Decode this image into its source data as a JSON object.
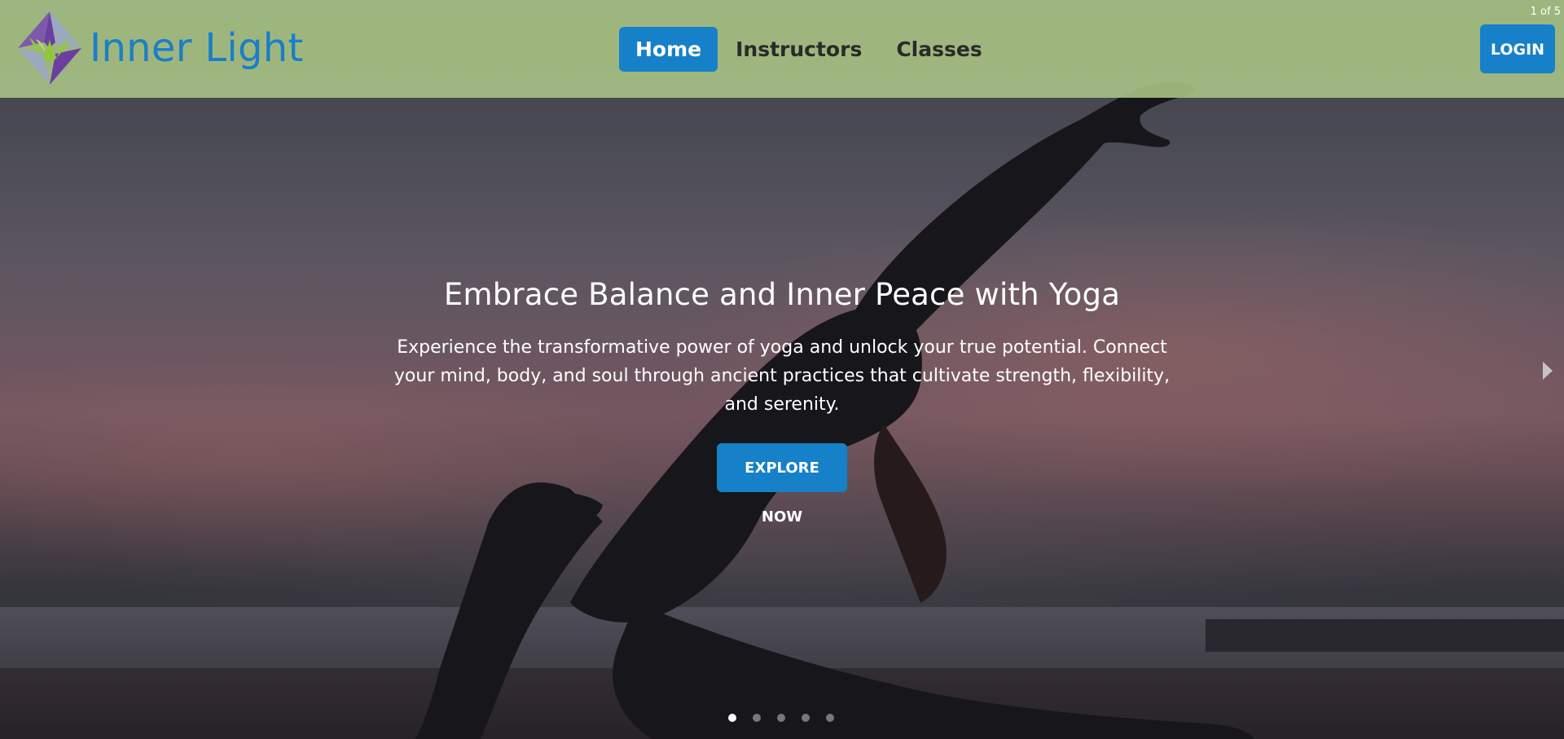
{
  "brand": {
    "name": "Inner Light",
    "logo_icon": "lotus-diamond-icon",
    "color": "#1a7fc6"
  },
  "nav": {
    "items": [
      {
        "label": "Home",
        "active": true
      },
      {
        "label": "Instructors",
        "active": false
      },
      {
        "label": "Classes",
        "active": false
      }
    ]
  },
  "header": {
    "login_label": "LOGIN",
    "background": "#a5be82"
  },
  "carousel": {
    "counter": "1 of 5",
    "current": 1,
    "total": 5,
    "next_icon": "triangle-right-icon"
  },
  "hero": {
    "title": "Embrace Balance and Inner Peace with Yoga",
    "text": "Experience the transformative power of yoga and unlock your true potential. Connect your mind, body, and soul through ancient practices that cultivate strength, flexibility, and serenity.",
    "button_label": "EXPLORE NOW"
  },
  "colors": {
    "accent": "#1680c8"
  }
}
